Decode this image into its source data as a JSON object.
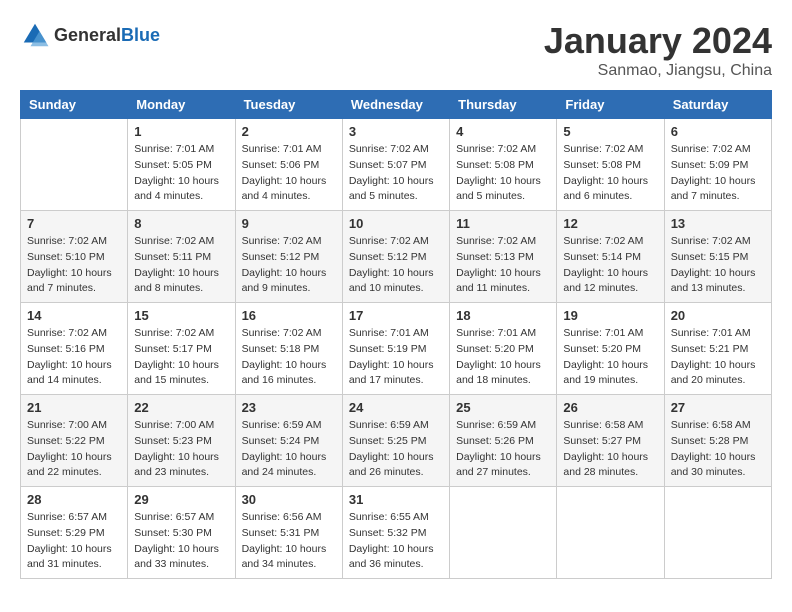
{
  "header": {
    "logo_general": "General",
    "logo_blue": "Blue",
    "month_title": "January 2024",
    "location": "Sanmao, Jiangsu, China"
  },
  "columns": [
    "Sunday",
    "Monday",
    "Tuesday",
    "Wednesday",
    "Thursday",
    "Friday",
    "Saturday"
  ],
  "weeks": [
    [
      {
        "day": "",
        "info": ""
      },
      {
        "day": "1",
        "info": "Sunrise: 7:01 AM\nSunset: 5:05 PM\nDaylight: 10 hours\nand 4 minutes."
      },
      {
        "day": "2",
        "info": "Sunrise: 7:01 AM\nSunset: 5:06 PM\nDaylight: 10 hours\nand 4 minutes."
      },
      {
        "day": "3",
        "info": "Sunrise: 7:02 AM\nSunset: 5:07 PM\nDaylight: 10 hours\nand 5 minutes."
      },
      {
        "day": "4",
        "info": "Sunrise: 7:02 AM\nSunset: 5:08 PM\nDaylight: 10 hours\nand 5 minutes."
      },
      {
        "day": "5",
        "info": "Sunrise: 7:02 AM\nSunset: 5:08 PM\nDaylight: 10 hours\nand 6 minutes."
      },
      {
        "day": "6",
        "info": "Sunrise: 7:02 AM\nSunset: 5:09 PM\nDaylight: 10 hours\nand 7 minutes."
      }
    ],
    [
      {
        "day": "7",
        "info": "Sunrise: 7:02 AM\nSunset: 5:10 PM\nDaylight: 10 hours\nand 7 minutes."
      },
      {
        "day": "8",
        "info": "Sunrise: 7:02 AM\nSunset: 5:11 PM\nDaylight: 10 hours\nand 8 minutes."
      },
      {
        "day": "9",
        "info": "Sunrise: 7:02 AM\nSunset: 5:12 PM\nDaylight: 10 hours\nand 9 minutes."
      },
      {
        "day": "10",
        "info": "Sunrise: 7:02 AM\nSunset: 5:12 PM\nDaylight: 10 hours\nand 10 minutes."
      },
      {
        "day": "11",
        "info": "Sunrise: 7:02 AM\nSunset: 5:13 PM\nDaylight: 10 hours\nand 11 minutes."
      },
      {
        "day": "12",
        "info": "Sunrise: 7:02 AM\nSunset: 5:14 PM\nDaylight: 10 hours\nand 12 minutes."
      },
      {
        "day": "13",
        "info": "Sunrise: 7:02 AM\nSunset: 5:15 PM\nDaylight: 10 hours\nand 13 minutes."
      }
    ],
    [
      {
        "day": "14",
        "info": "Sunrise: 7:02 AM\nSunset: 5:16 PM\nDaylight: 10 hours\nand 14 minutes."
      },
      {
        "day": "15",
        "info": "Sunrise: 7:02 AM\nSunset: 5:17 PM\nDaylight: 10 hours\nand 15 minutes."
      },
      {
        "day": "16",
        "info": "Sunrise: 7:02 AM\nSunset: 5:18 PM\nDaylight: 10 hours\nand 16 minutes."
      },
      {
        "day": "17",
        "info": "Sunrise: 7:01 AM\nSunset: 5:19 PM\nDaylight: 10 hours\nand 17 minutes."
      },
      {
        "day": "18",
        "info": "Sunrise: 7:01 AM\nSunset: 5:20 PM\nDaylight: 10 hours\nand 18 minutes."
      },
      {
        "day": "19",
        "info": "Sunrise: 7:01 AM\nSunset: 5:20 PM\nDaylight: 10 hours\nand 19 minutes."
      },
      {
        "day": "20",
        "info": "Sunrise: 7:01 AM\nSunset: 5:21 PM\nDaylight: 10 hours\nand 20 minutes."
      }
    ],
    [
      {
        "day": "21",
        "info": "Sunrise: 7:00 AM\nSunset: 5:22 PM\nDaylight: 10 hours\nand 22 minutes."
      },
      {
        "day": "22",
        "info": "Sunrise: 7:00 AM\nSunset: 5:23 PM\nDaylight: 10 hours\nand 23 minutes."
      },
      {
        "day": "23",
        "info": "Sunrise: 6:59 AM\nSunset: 5:24 PM\nDaylight: 10 hours\nand 24 minutes."
      },
      {
        "day": "24",
        "info": "Sunrise: 6:59 AM\nSunset: 5:25 PM\nDaylight: 10 hours\nand 26 minutes."
      },
      {
        "day": "25",
        "info": "Sunrise: 6:59 AM\nSunset: 5:26 PM\nDaylight: 10 hours\nand 27 minutes."
      },
      {
        "day": "26",
        "info": "Sunrise: 6:58 AM\nSunset: 5:27 PM\nDaylight: 10 hours\nand 28 minutes."
      },
      {
        "day": "27",
        "info": "Sunrise: 6:58 AM\nSunset: 5:28 PM\nDaylight: 10 hours\nand 30 minutes."
      }
    ],
    [
      {
        "day": "28",
        "info": "Sunrise: 6:57 AM\nSunset: 5:29 PM\nDaylight: 10 hours\nand 31 minutes."
      },
      {
        "day": "29",
        "info": "Sunrise: 6:57 AM\nSunset: 5:30 PM\nDaylight: 10 hours\nand 33 minutes."
      },
      {
        "day": "30",
        "info": "Sunrise: 6:56 AM\nSunset: 5:31 PM\nDaylight: 10 hours\nand 34 minutes."
      },
      {
        "day": "31",
        "info": "Sunrise: 6:55 AM\nSunset: 5:32 PM\nDaylight: 10 hours\nand 36 minutes."
      },
      {
        "day": "",
        "info": ""
      },
      {
        "day": "",
        "info": ""
      },
      {
        "day": "",
        "info": ""
      }
    ]
  ]
}
